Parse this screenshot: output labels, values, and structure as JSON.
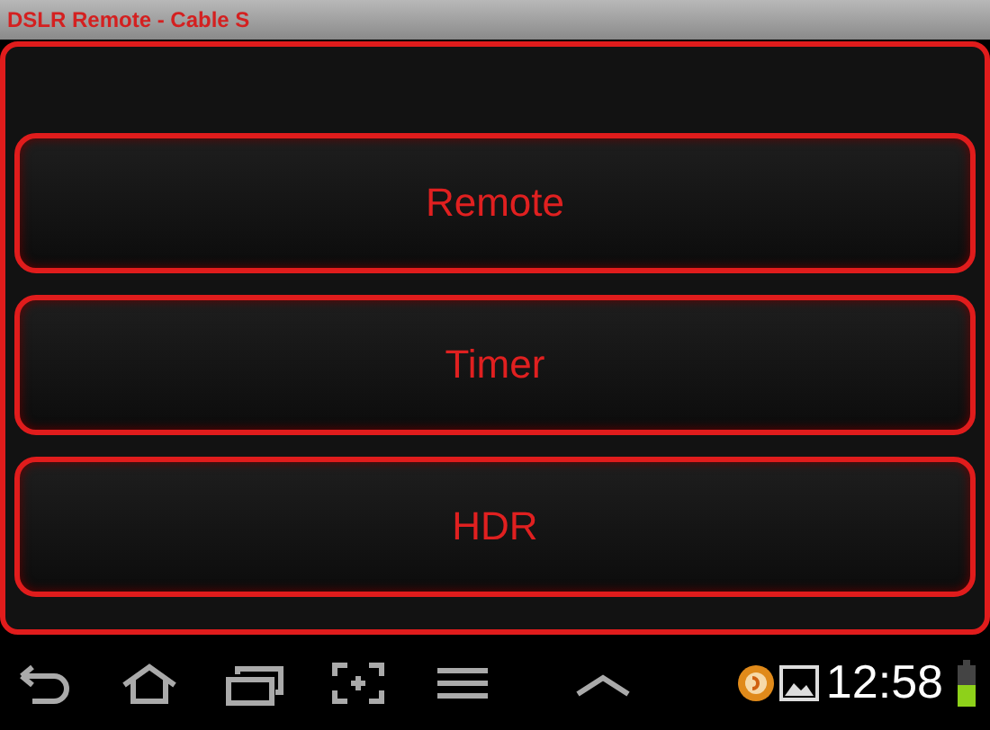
{
  "window": {
    "title": "DSLR Remote - Cable S"
  },
  "buttons": [
    {
      "label": "Remote"
    },
    {
      "label": "Timer"
    },
    {
      "label": "HDR"
    }
  ],
  "status_bar": {
    "time": "12:58"
  }
}
